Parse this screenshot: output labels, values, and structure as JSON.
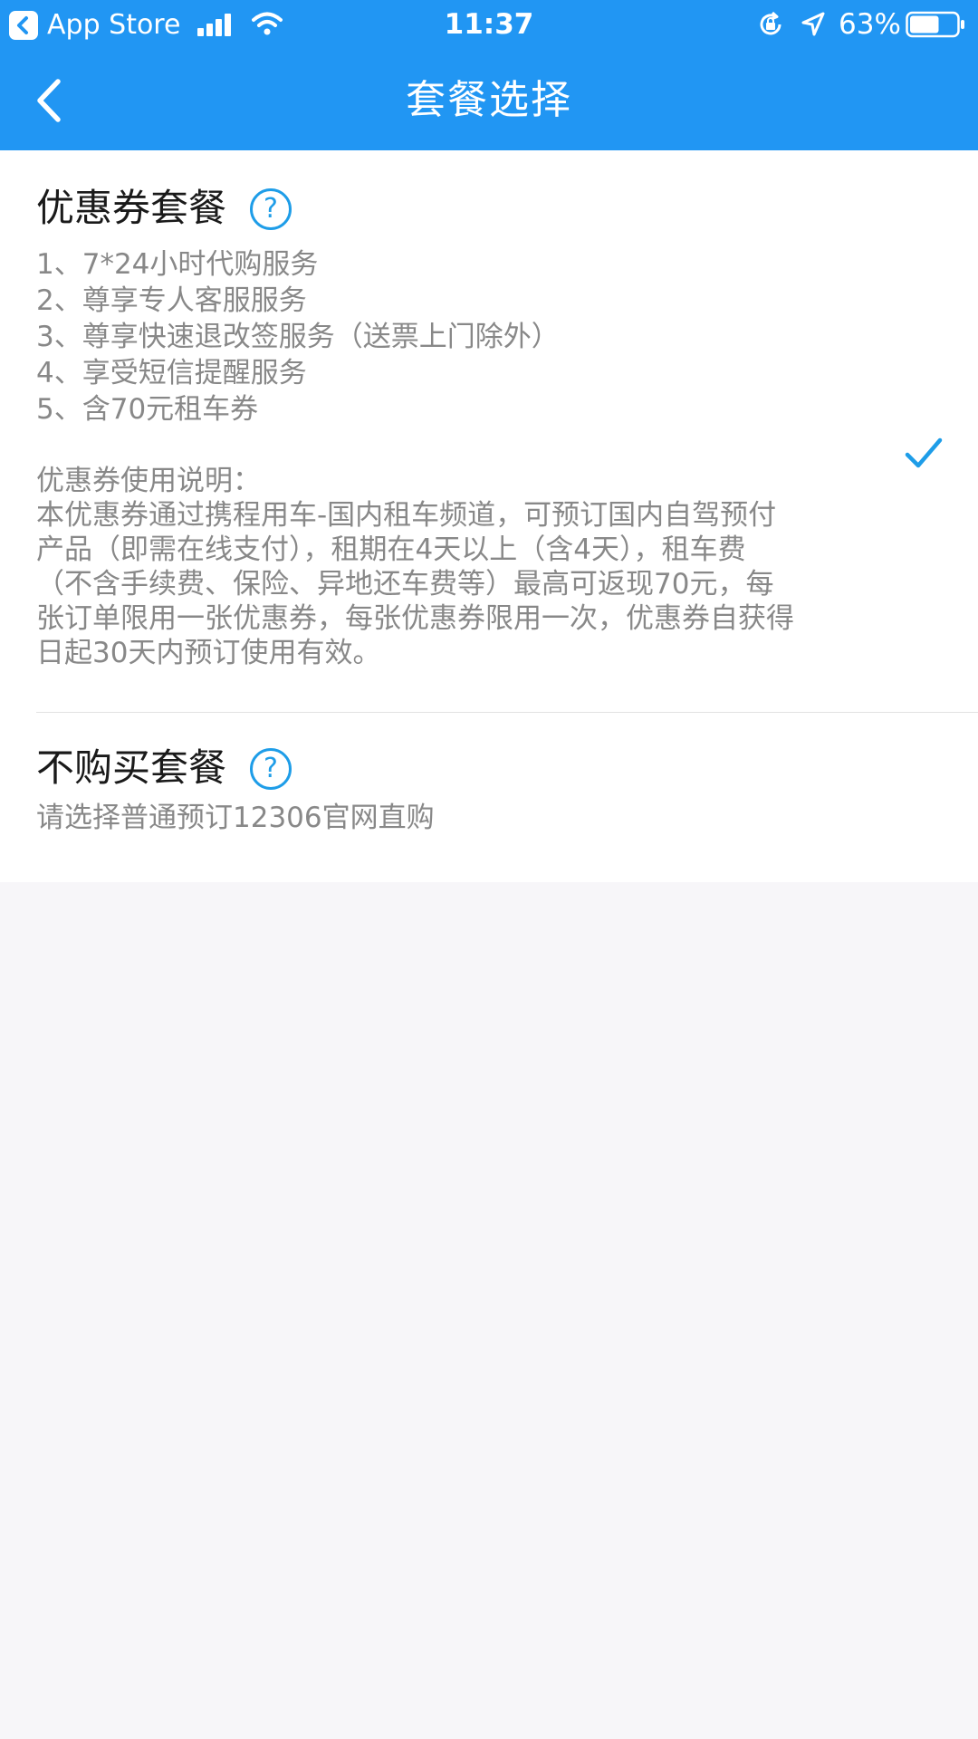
{
  "status_bar": {
    "back_app_label": "App Store",
    "time": "11:37",
    "battery_percent": "63%",
    "battery_level": 0.63,
    "icons": [
      "signal-icon",
      "wifi-icon",
      "lock-rotation-icon",
      "location-icon",
      "battery-icon"
    ]
  },
  "nav": {
    "title": "套餐选择",
    "back_icon": "chevron-left-icon"
  },
  "packages": {
    "coupon": {
      "title": "优惠券套餐",
      "help_icon": "?",
      "selected": true,
      "benefits": [
        "1、7*24小时代购服务",
        "2、尊享专人客服服务",
        "3、尊享快速退改签服务（送票上门除外）",
        "4、享受短信提醒服务",
        "5、含70元租车券"
      ],
      "usage_title": "优惠券使用说明：",
      "usage_lines": [
        "本优惠券通过携程用车-国内租车频道，可预订国内自驾预付",
        "产品（即需在线支付），租期在4天以上（含4天），租车费",
        "（不含手续费、保险、异地还车费等）最高可返现70元，每",
        "张订单限用一张优惠券，每张优惠券限用一次，优惠券自获得",
        "日起30天内预订使用有效。"
      ]
    },
    "none": {
      "title": "不购买套餐",
      "help_icon": "?",
      "subtitle": "请选择普通预订12306官网直购"
    }
  },
  "colors": {
    "header": "#2196f3",
    "accent": "#1e9de8",
    "page_background": "#f7f6f9",
    "card_background": "#ffffff",
    "secondary_text": "#888888",
    "primary_text": "#1a1a1a"
  }
}
